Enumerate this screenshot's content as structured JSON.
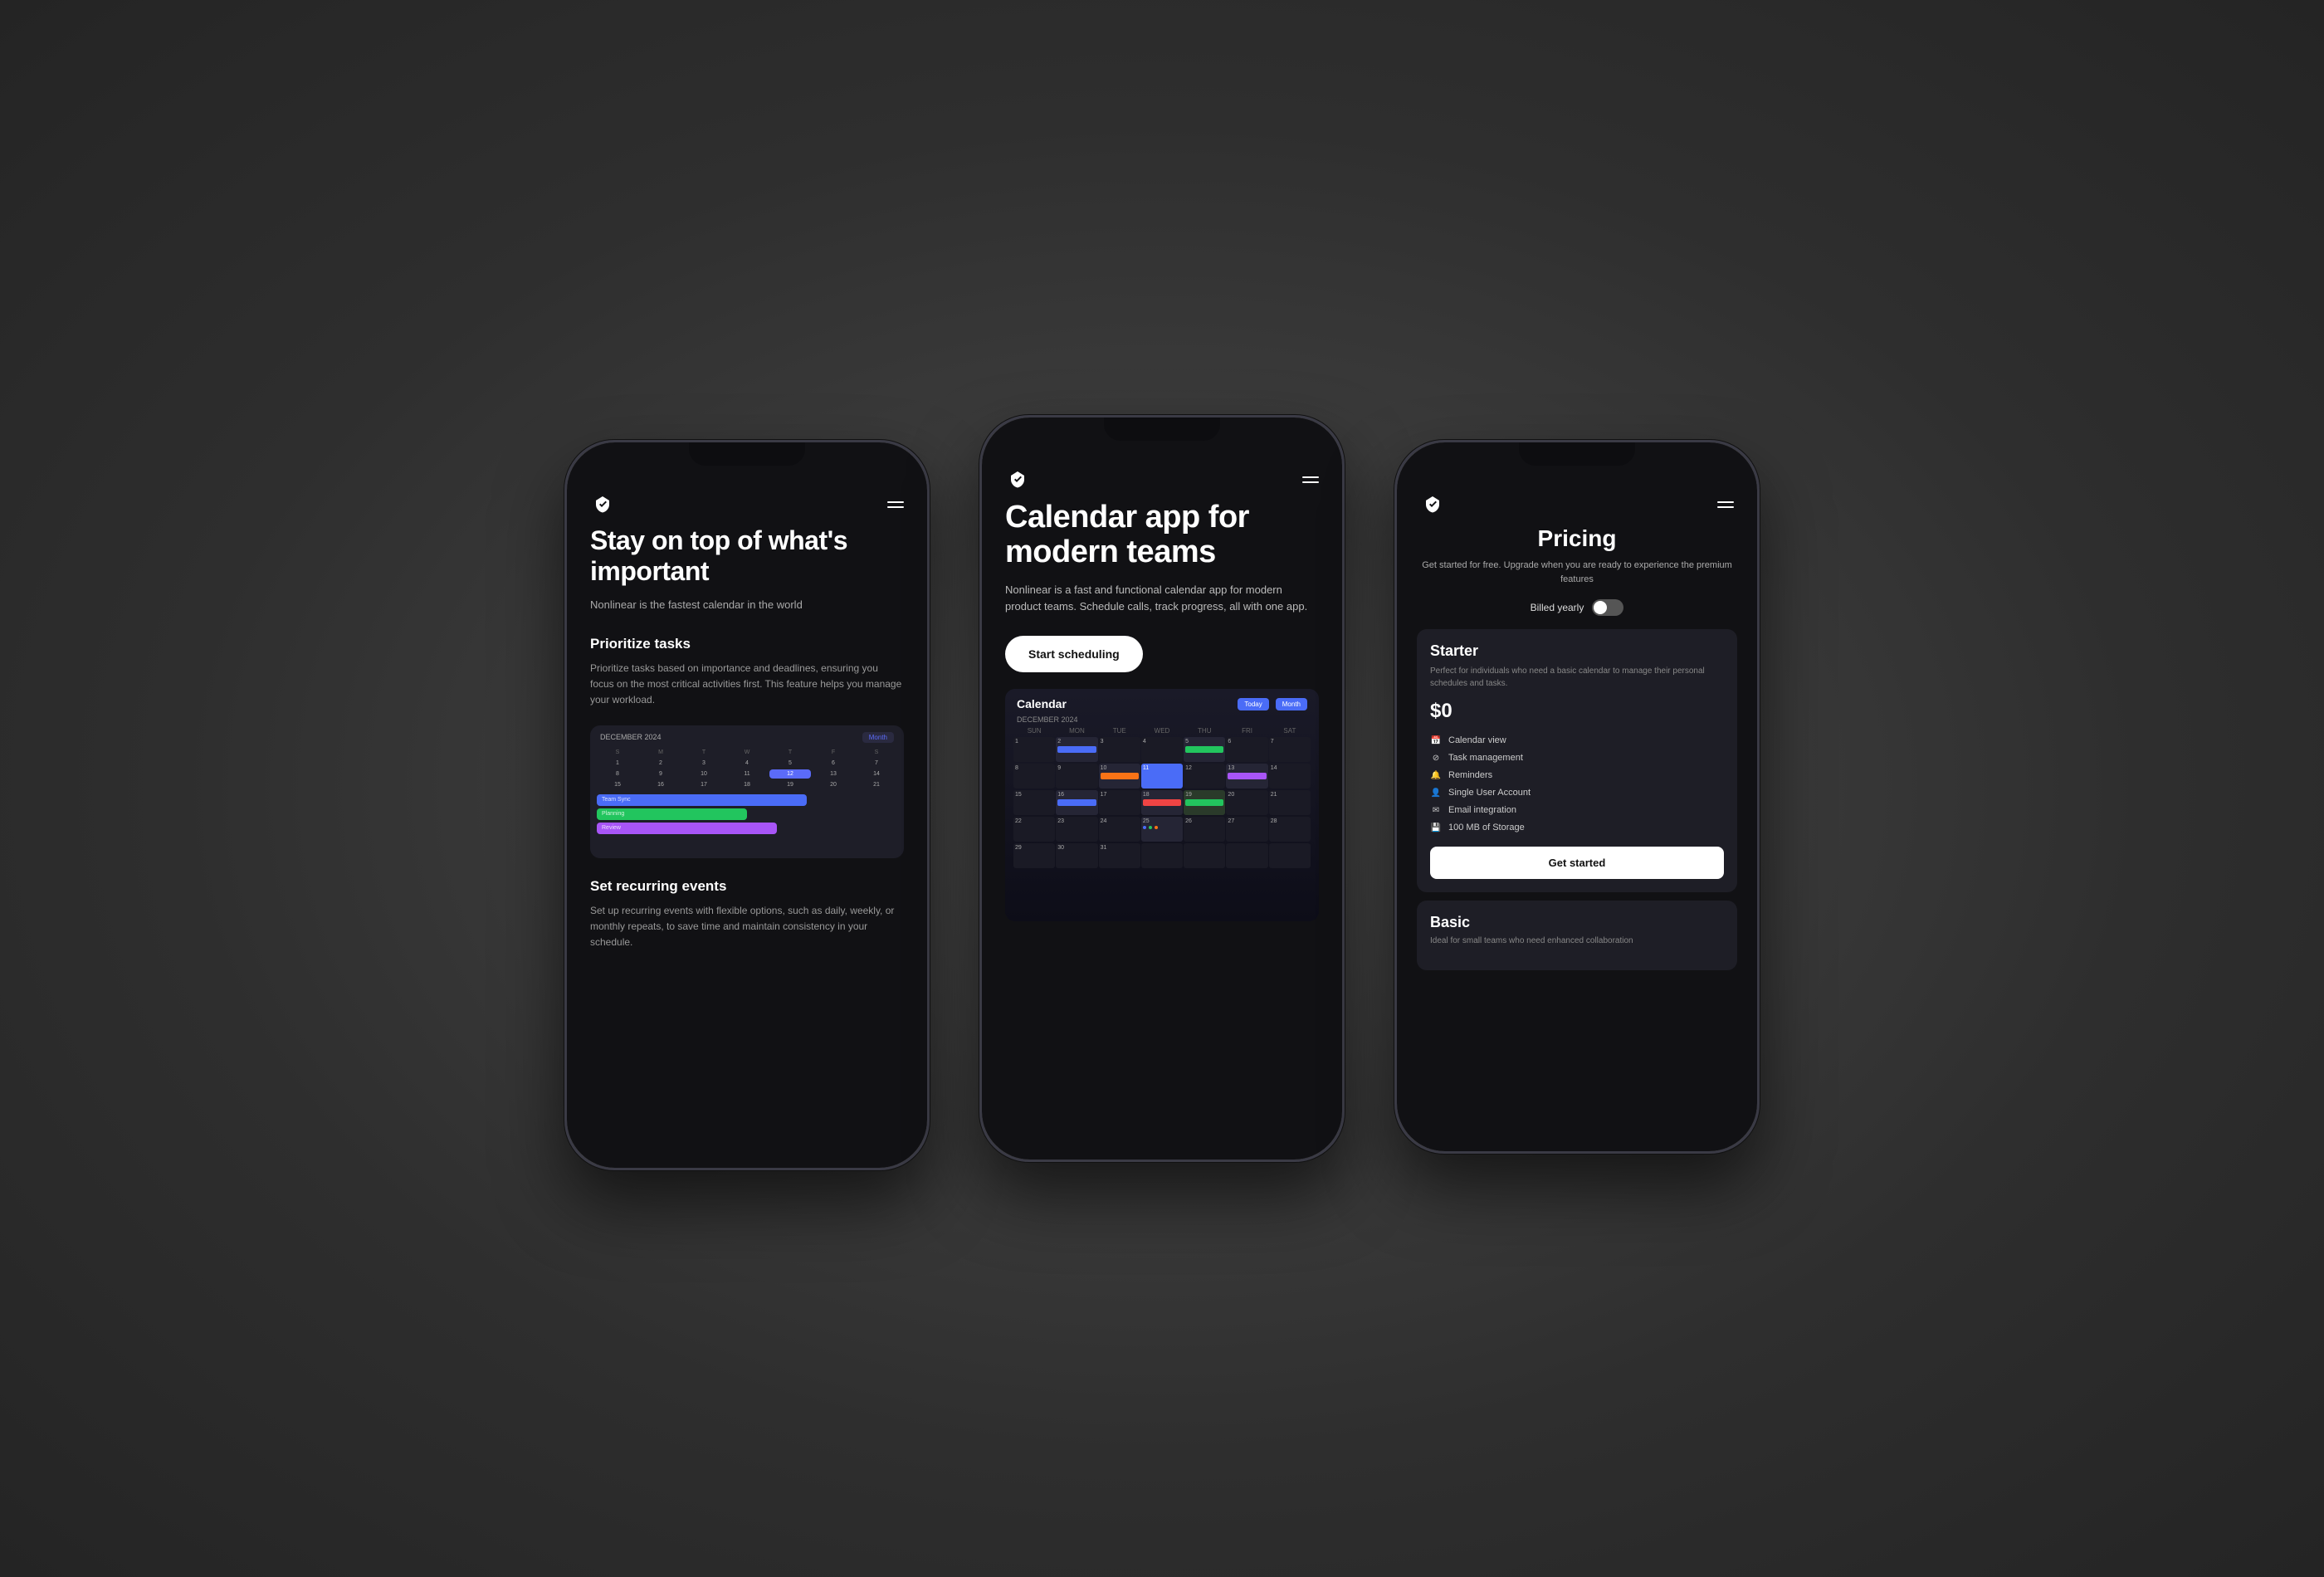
{
  "background": "#3a3a3a",
  "phones": {
    "left": {
      "logo": "nonlinear-logo",
      "menu": "menu",
      "hero_title": "Stay on top of what's important",
      "hero_subtitle": "Nonlinear is the fastest calendar in the world",
      "feature1_title": "Prioritize tasks",
      "feature1_desc": "Prioritize tasks based on importance and deadlines, ensuring you focus on the most critical activities first. This feature helps you manage your workload.",
      "feature2_title": "Set recurring events",
      "feature2_desc": "Set up recurring events with flexible options, such as daily, weekly, or monthly repeats, to save time and maintain consistency in your schedule."
    },
    "center": {
      "logo": "nonlinear-logo",
      "menu": "menu",
      "hero_title": "Calendar app for modern teams",
      "hero_subtitle": "Nonlinear is a fast and functional calendar app for modern product teams. Schedule calls, track progress, all with one app.",
      "cta_label": "Start scheduling",
      "calendar_title": "Calendar",
      "calendar_month": "DECEMBER 2024"
    },
    "right": {
      "logo": "nonlinear-logo",
      "menu": "menu",
      "pricing_title": "Pricing",
      "pricing_subtitle": "Get started for free. Upgrade when you are ready to experience the premium features",
      "billing_label": "Billed yearly",
      "starter": {
        "title": "Starter",
        "desc": "Perfect for individuals who need a basic calendar to manage their personal schedules and tasks.",
        "price": "$0",
        "features": [
          "Calendar view",
          "Task management",
          "Reminders",
          "Single User Account",
          "Email integration",
          "100 MB of Storage"
        ],
        "cta": "Get started"
      },
      "basic": {
        "title": "Basic",
        "desc": "Ideal for small teams who need enhanced collaboration"
      }
    }
  }
}
